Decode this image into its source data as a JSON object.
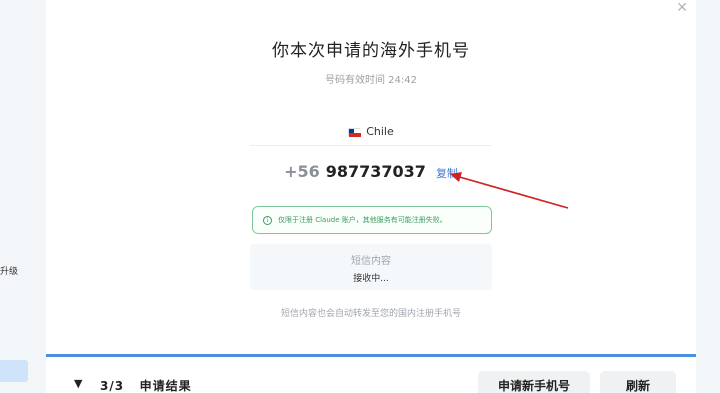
{
  "background": {
    "left_label": "升级"
  },
  "modal": {
    "title": "你本次申请的海外手机号",
    "timer_label": "号码有效时间 24:42",
    "country": {
      "name": "Chile",
      "flag": "chile-flag"
    },
    "phone": {
      "prefix": "+56",
      "number": "987737037",
      "copy_label": "复制"
    },
    "notice": "仅限于注册 Claude 账户，其他服务有可能注册失败。",
    "sms": {
      "title": "短信内容",
      "status": "接收中..."
    },
    "forward_hint": "短信内容也会自动转发至您的国内注册手机号",
    "close_icon": "close-icon"
  },
  "bottom_bar": {
    "step_indicator": "3/3",
    "step_label": "申请结果",
    "new_number_button": "申请新手机号",
    "refresh_button": "刷新"
  },
  "colors": {
    "accent": "#3a7bd5",
    "notice_green": "#3f9a61",
    "annotation_red": "#d21f1f"
  }
}
